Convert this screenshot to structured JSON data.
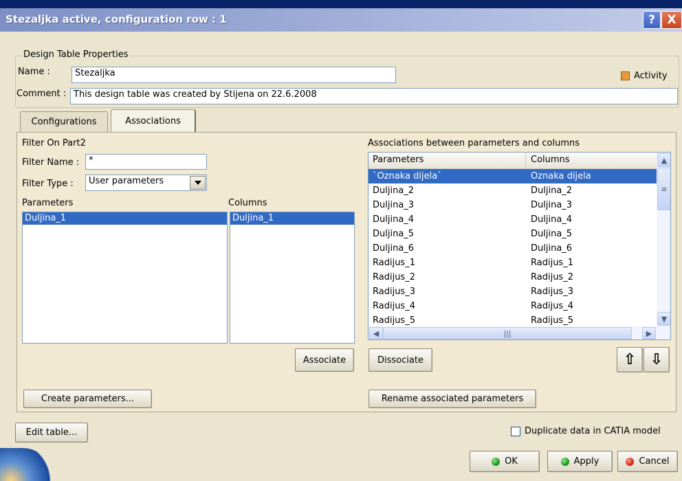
{
  "window": {
    "title": "Stezaljka active, configuration row : 1",
    "help_label": "?",
    "close_label": "X"
  },
  "properties": {
    "legend": "Design Table Properties",
    "name_label": "Name :",
    "name_value": "Stezaljka",
    "comment_label": "Comment :",
    "comment_value": "This design table was created by Stijena on 22.6.2008",
    "activity_label": "Activity",
    "activity_checked": true
  },
  "tabs": [
    {
      "label": "Configurations",
      "active": false
    },
    {
      "label": "Associations",
      "active": true
    }
  ],
  "filter": {
    "title": "Filter On Part2",
    "name_label": "Filter Name :",
    "name_value": "*",
    "type_label": "Filter Type :",
    "type_value": "User parameters"
  },
  "parameters_list": {
    "header": "Parameters",
    "items": [
      "Duljina_1"
    ]
  },
  "columns_list": {
    "header": "Columns",
    "items": [
      "Duljina_1"
    ]
  },
  "associations": {
    "title": "Associations between parameters and columns",
    "col_parameters": "Parameters",
    "col_columns": "Columns",
    "rows": [
      {
        "param": "`Oznaka dijela`",
        "column": "Oznaka dijela"
      },
      {
        "param": "Duljina_2",
        "column": "Duljina_2"
      },
      {
        "param": "Duljina_3",
        "column": "Duljina_3"
      },
      {
        "param": "Duljina_4",
        "column": "Duljina_4"
      },
      {
        "param": "Duljina_5",
        "column": "Duljina_5"
      },
      {
        "param": "Duljina_6",
        "column": "Duljina_6"
      },
      {
        "param": "Radijus_1",
        "column": "Radijus_1"
      },
      {
        "param": "Radijus_2",
        "column": "Radijus_2"
      },
      {
        "param": "Radijus_3",
        "column": "Radijus_3"
      },
      {
        "param": "Radijus_4",
        "column": "Radijus_4"
      },
      {
        "param": "Radijus_5",
        "column": "Radijus_5"
      }
    ]
  },
  "buttons": {
    "associate": "Associate",
    "dissociate": "Dissociate",
    "move_up": "⇧",
    "move_down": "⇩",
    "create_parameters": "Create parameters...",
    "rename_associated": "Rename associated parameters",
    "edit_table": "Edit table...",
    "ok": "OK",
    "apply": "Apply",
    "cancel": "Cancel"
  },
  "duplicate": {
    "label": "Duplicate data in CATIA model",
    "checked": false
  },
  "colors": {
    "title_bar_start": "#7d8fc4",
    "dialog_bg": "#ebe4cf",
    "selection": "#316ac5",
    "ok_dot": "#1e9a1e",
    "apply_dot": "#1e9a1e",
    "cancel_dot": "#d42a1a",
    "activity_box": "#e69a3a"
  },
  "icons": [
    "help-icon",
    "close-icon",
    "arrow-up-icon",
    "arrow-down-icon",
    "dropdown-arrow-icon"
  ]
}
